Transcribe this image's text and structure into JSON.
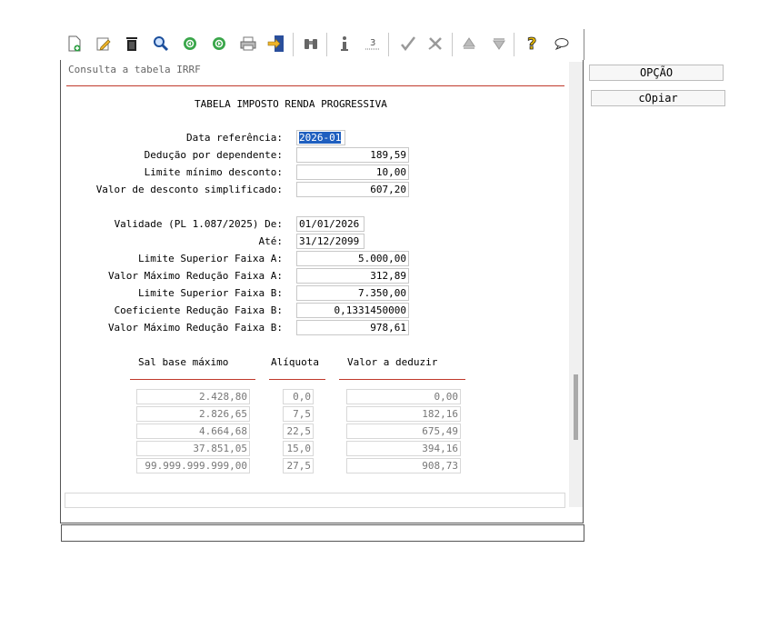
{
  "toolbar": {
    "icons": [
      "new-document-icon",
      "edit-icon",
      "delete-icon",
      "search-icon",
      "previous-icon",
      "next-icon",
      "print-icon",
      "export-icon",
      "binoculars-icon",
      "info-icon",
      "numbering-icon",
      "confirm-icon",
      "cancel-icon",
      "up-icon",
      "down-icon",
      "help-icon",
      "comment-icon"
    ]
  },
  "screen": {
    "title": "Consulta a tabela IRRF",
    "heading": "TABELA IMPOSTO RENDA PROGRESSIVA"
  },
  "fields": {
    "data_referencia": {
      "label": "Data referência:",
      "value": "2026-01"
    },
    "deducao_dependente": {
      "label": "Dedução por dependente:",
      "value": "189,59"
    },
    "limite_minimo": {
      "label": "Limite mínimo desconto:",
      "value": "10,00"
    },
    "desconto_simplificado": {
      "label": "Valor de desconto simplificado:",
      "value": "607,20"
    },
    "validade_de": {
      "label": "Validade (PL 1.087/2025) De:",
      "value": "01/01/2026"
    },
    "validade_ate": {
      "label": "Até:",
      "value": "31/12/2099"
    },
    "limite_sup_a": {
      "label": "Limite Superior Faixa A:",
      "value": "5.000,00"
    },
    "max_reducao_a": {
      "label": "Valor Máximo Redução Faixa A:",
      "value": "312,89"
    },
    "limite_sup_b": {
      "label": "Limite Superior Faixa B:",
      "value": "7.350,00"
    },
    "coef_reducao_b": {
      "label": "Coeficiente Redução Faixa B:",
      "value": "0,1331450000"
    },
    "max_reducao_b": {
      "label": "Valor Máximo Redução Faixa B:",
      "value": "978,61"
    }
  },
  "table": {
    "headers": [
      "Sal base máximo",
      "Alíquota",
      "Valor a deduzir"
    ],
    "rows": [
      [
        "2.428,80",
        "0,0",
        "0,00"
      ],
      [
        "2.826,65",
        "7,5",
        "182,16"
      ],
      [
        "4.664,68",
        "22,5",
        "675,49"
      ],
      [
        "37.851,05",
        "15,0",
        "394,16"
      ],
      [
        "99.999.999.999,00",
        "27,5",
        "908,73"
      ]
    ]
  },
  "side": {
    "opcao": "OPÇÃO",
    "copiar": "cOpiar"
  },
  "colors": {
    "accent_red": "#c0392b",
    "selection": "#1f5fbf"
  }
}
